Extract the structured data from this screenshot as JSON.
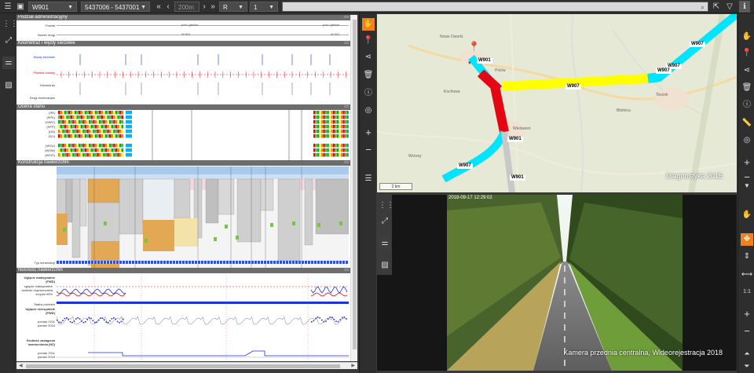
{
  "toolbar": {
    "road_select": "W901",
    "segment_select": "5437006 - 5437001",
    "distance_value": "200m",
    "direction_select": "R",
    "lane_select": "1",
    "search_placeholder": ""
  },
  "sections": {
    "admin": {
      "title": "Podział administracyjny",
      "row_labels": [
        "Powiat",
        "Numer drogi"
      ],
      "powiat_values": [
        "pow. gliwice",
        "pow. gliwice"
      ],
      "road_values": [
        "W 901",
        "W 901"
      ]
    },
    "km": {
      "title": "Kilometraż i węzły sieciowe",
      "row_labels": [
        "Węzły sieciowe",
        "Pikietaż lokalny",
        "Kilometraż",
        "Drogi dochodzące"
      ]
    },
    "state": {
      "title": "Ocena stanu",
      "row_labels": [
        "(IRI)",
        "(SPK)",
        "(SWO)",
        "(SPP)",
        "(UA)",
        "(SO)",
        "",
        "(WSU)",
        "(WSW)",
        "(WOG)"
      ]
    },
    "construction": {
      "title": "Konstrukcja nawierzchni",
      "footer_label": "Typ konstrukcji"
    },
    "capacity": {
      "title": "Nośność nawierzchni",
      "row_labels": [
        "Ugięcie maksymalne (FWD)",
        "Status pomiaru",
        "Ugięcie rzeczywiste (FWD)",
        "Grubość zastępcza wzmocnienia (HZ)"
      ],
      "legend_max": [
        "ugięcie maksymalne",
        "wartość dopuszczalna",
        "krzywa 95%"
      ],
      "legend_years": [
        "pomiar 2011",
        "pomiar 2018"
      ]
    }
  },
  "map": {
    "credit": "Diagnostyka 2015",
    "scale_label": "2 km",
    "road_labels": [
      "W901",
      "W907",
      "W907",
      "W907",
      "W907",
      "W901",
      "W907",
      "W901"
    ],
    "place_labels": [
      "Nowe Dworki",
      "Toszek",
      "Pniów",
      "Wielowieś",
      "Kochowa",
      "Błotnica",
      "Wrzosy"
    ]
  },
  "camera": {
    "timestamp": "2018-09-17 12:29:02",
    "caption": "Kamera przednia centralna, Wideorejestracja 2018"
  },
  "colors": {
    "accent": "#f0821e",
    "panel_bg": "#2e2e2e",
    "section_head": "#6d6d6d",
    "road_good": "#00e5ff",
    "road_warning": "#ffff00",
    "road_bad": "#e30613"
  }
}
